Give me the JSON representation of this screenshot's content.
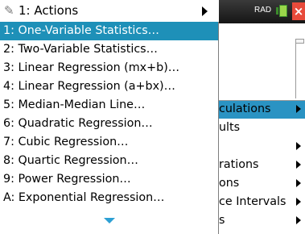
{
  "header": {
    "icon": "spreadsheet-tools-icon",
    "title": "1: Actions"
  },
  "status": {
    "mode": "RAD",
    "battery_icon": "battery-icon",
    "close_icon": "close-icon"
  },
  "menu": {
    "items": [
      {
        "label": "1: One-Variable Statistics…",
        "selected": true
      },
      {
        "label": "2: Two-Variable Statistics…"
      },
      {
        "label": "3: Linear Regression (mx+b)…"
      },
      {
        "label": "4: Linear Regression (a+bx)…"
      },
      {
        "label": "5: Median-Median Line…"
      },
      {
        "label": "6: Quadratic Regression…"
      },
      {
        "label": "7: Cubic Regression…"
      },
      {
        "label": "8: Quartic Regression…"
      },
      {
        "label": "9: Power Regression…"
      },
      {
        "label": "A: Exponential Regression…"
      }
    ],
    "more_icon": "scroll-down-icon"
  },
  "background_submenu": {
    "items": [
      {
        "label": "culations",
        "has_submenu": true
      },
      {
        "label": "ults",
        "has_submenu": false
      },
      {
        "label": "",
        "has_submenu": true
      },
      {
        "label": "rations",
        "has_submenu": true
      },
      {
        "label": "ons",
        "has_submenu": true
      },
      {
        "label": "ce Intervals",
        "has_submenu": true
      },
      {
        "label": "s",
        "has_submenu": true
      }
    ]
  },
  "colors": {
    "selection": "#1e90b8",
    "submenu_highlight": "#2a93c3",
    "scroll_arrow": "#2da0d4",
    "close": "#e84b3b"
  }
}
